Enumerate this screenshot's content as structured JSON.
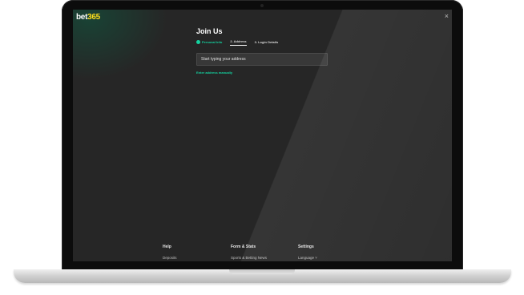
{
  "brand": {
    "part1": "bet",
    "part2": "365"
  },
  "close_glyph": "×",
  "page_title": "Join Us",
  "steps": [
    {
      "label": "Personal Info",
      "state": "done"
    },
    {
      "label": "2.  Address",
      "state": "active"
    },
    {
      "label": "3.  Login Details",
      "state": "pending"
    }
  ],
  "address": {
    "placeholder": "Start typing your address",
    "value": ""
  },
  "manual_link": "Enter address manually",
  "footer": {
    "help": {
      "heading": "Help",
      "link": "Deposits"
    },
    "forms": {
      "heading": "Form & Stats",
      "link": "Sports & Betting News"
    },
    "settings": {
      "heading": "Settings",
      "link": "Language ˅"
    }
  },
  "colors": {
    "accent": "#14d3a0",
    "brand_yellow": "#ffdf1b",
    "background": "#262626"
  }
}
